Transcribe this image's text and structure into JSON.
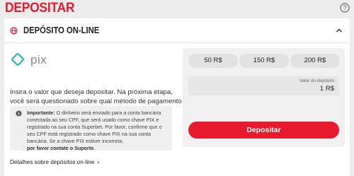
{
  "header": {
    "title": "DEPOSITAR",
    "help_icon": "question-circle-icon"
  },
  "section": {
    "icon": "globe-icon",
    "title": "DEPÓSITO ON-LINE",
    "collapse_icon": "chevron-up-icon"
  },
  "method": {
    "logo": "pix-logo",
    "logo_text": "pix",
    "description": "Insira o valor que deseja depositar. Na próxima etapa, você será questionado sobre qual método de pagamento prefere adicionar à sua conta."
  },
  "notice": {
    "icon": "info-icon",
    "important_label": "Importante:",
    "body": " O dinheiro será enviado para a conta bancária conectada ao seu CPF, que será usado como chave PIX e registrado na sua conta Superbet. Por favor, confirme que o seu CPF está registrado como chave PIX na sua conta bancária. Se a chave PIX estiver incorreta,",
    "contact": "por favor contate o Suporte."
  },
  "details_link": {
    "label": "Detalhes sobre depósitos on-line",
    "arrow": "›"
  },
  "amounts": [
    "50 R$",
    "150 R$",
    "200 R$"
  ],
  "amount_field": {
    "label": "Valor do depósito",
    "value": "1 R$"
  },
  "deposit_button": {
    "label": "Depositar"
  },
  "colors": {
    "brand_red": "#e8192c",
    "pix_teal": "#32bcad"
  }
}
